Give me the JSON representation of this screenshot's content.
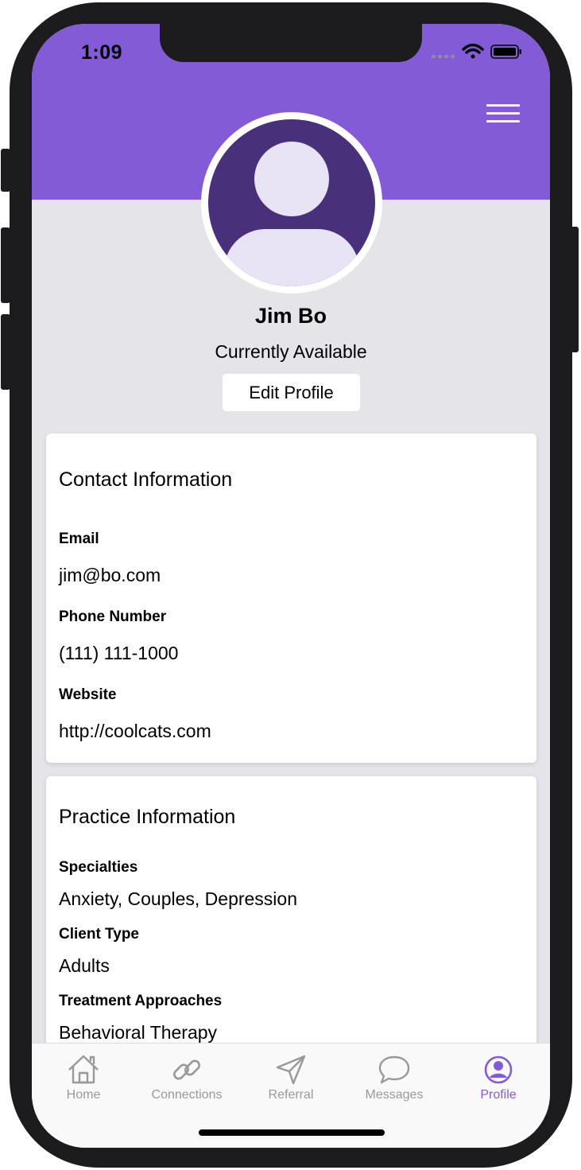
{
  "status_bar": {
    "time": "1:09"
  },
  "profile": {
    "name": "Jim Bo",
    "availability": "Currently Available",
    "edit_button_label": "Edit Profile"
  },
  "contact_card": {
    "title": "Contact Information",
    "fields": [
      {
        "label": "Email",
        "value": "jim@bo.com"
      },
      {
        "label": "Phone Number",
        "value": "(111) 111-1000"
      },
      {
        "label": "Website",
        "value": "http://coolcats.com"
      }
    ]
  },
  "practice_card": {
    "title": "Practice Information",
    "fields": [
      {
        "label": "Specialties",
        "value": "Anxiety, Couples, Depression"
      },
      {
        "label": "Client Type",
        "value": "Adults"
      },
      {
        "label": "Treatment Approaches",
        "value": "Behavioral Therapy"
      }
    ]
  },
  "tab_bar": {
    "active_tab": "Profile",
    "tabs": [
      {
        "label": "Home",
        "icon": "home-icon"
      },
      {
        "label": "Connections",
        "icon": "link-icon"
      },
      {
        "label": "Referral",
        "icon": "paper-plane-icon"
      },
      {
        "label": "Messages",
        "icon": "chat-bubble-icon"
      },
      {
        "label": "Profile",
        "icon": "user-circle-icon"
      }
    ]
  },
  "colors": {
    "accent": "#835bd7",
    "avatar_background": "#48307a",
    "page_background": "#e5e4e9",
    "inactive_tab": "#999999"
  }
}
